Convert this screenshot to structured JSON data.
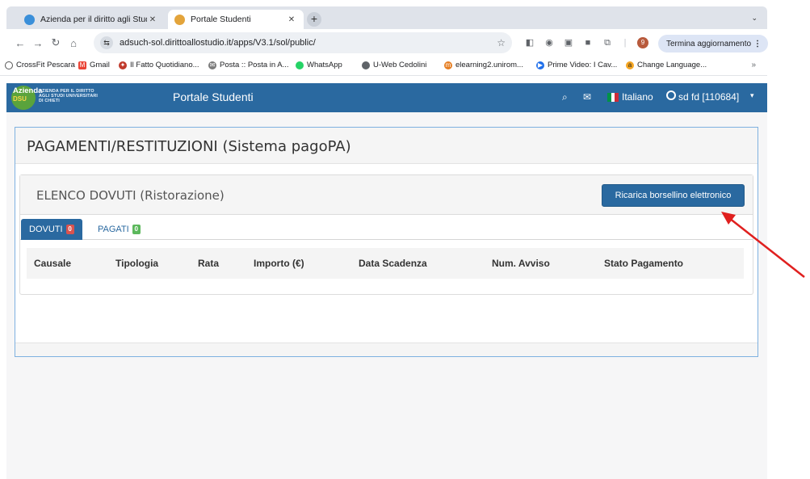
{
  "browser": {
    "tabs": [
      {
        "title": "Azienda per il diritto agli Stud",
        "close": "✕",
        "favicon_color": "#3a8fd9"
      },
      {
        "title": "Portale Studenti",
        "close": "✕",
        "favicon_color": "#e3a43b"
      }
    ],
    "new_tab": "+",
    "tab_menu": "⌄",
    "url": "adsuch-sol.dirittoallostudio.it/apps/V3.1/sol/public/",
    "site_info_icon": "⇆",
    "profile_letter": "9",
    "update_label": "Termina aggiornamento",
    "update_menu": "⋮",
    "bookmarks": [
      {
        "label": "CrossFit Pescara",
        "color": "#ffffff",
        "icon": "◯"
      },
      {
        "label": "Gmail",
        "color": "#ea4335",
        "icon": "M"
      },
      {
        "label": "Il Fatto Quotidiano...",
        "color": "#c0392b",
        "icon": "✦"
      },
      {
        "label": "Posta :: Posta in A...",
        "color": "#7a7a7a",
        "icon": "✉"
      },
      {
        "label": "WhatsApp",
        "color": "#25d366",
        "icon": "●"
      },
      {
        "label": "U-Web Cedolini",
        "color": "#5f6368",
        "icon": "◎"
      },
      {
        "label": "elearning2.unirom...",
        "color": "#e67e22",
        "icon": "m"
      },
      {
        "label": "Prime Video: I Cav...",
        "color": "#1f6feb",
        "icon": "▶"
      },
      {
        "label": "Change Language...",
        "color": "#f5a623",
        "icon": "a"
      }
    ],
    "bookmarks_more": "»"
  },
  "header": {
    "logo_word": "Azienda",
    "logo_dsu": "DSU",
    "logo_lines": [
      "AZIENDA PER IL DIRITTO",
      "AGLI STUDI UNIVERSITARI",
      "DI CHIETI"
    ],
    "portal_title": "Portale Studenti",
    "chat_icon": "⌕",
    "mail_icon": "✉",
    "language": "Italiano",
    "user": "sd fd [110684]",
    "caret": "▾",
    "flag_colors": [
      "#009246",
      "#ffffff",
      "#ce2b37"
    ]
  },
  "main": {
    "title": "PAGAMENTI/RESTITUZIONI (Sistema pagoPA)",
    "section_title": "ELENCO DOVUTI (Ristorazione)",
    "recharge_button": "Ricarica borsellino elettronico",
    "tabs": [
      {
        "label": "DOVUTI",
        "count": "0",
        "badge_color": "#d9534f"
      },
      {
        "label": "PAGATI",
        "count": "0",
        "badge_color": "#5cb85c"
      }
    ],
    "columns": [
      "Causale",
      "Tipologia",
      "Rata",
      "Importo (€)",
      "Data Scadenza",
      "Num. Avviso",
      "Stato Pagamento"
    ]
  },
  "annotation": {
    "arrow_color": "#e0201f"
  }
}
